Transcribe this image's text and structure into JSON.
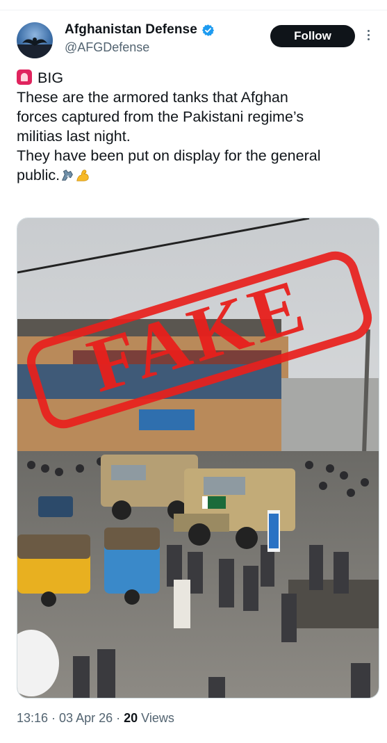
{
  "author": {
    "display_name": "Afghanistan Defense",
    "handle": "@AFGDefense",
    "verified": true,
    "avatar_icon": "eagle-emblem-icon"
  },
  "actions": {
    "follow_label": "Follow",
    "more_icon": "more-vertical-icon"
  },
  "tweet": {
    "lines": [
      "BIG",
      "These are the armored tanks that Afghan",
      "forces captured from the Pakistani regime’s",
      "militias last night.",
      "They have been put on display for the general",
      "public."
    ],
    "lead_icon": "rotating-light-icon",
    "trailing_icons": [
      "mechanical-arm-icon",
      "flexed-biceps-icon"
    ]
  },
  "media": {
    "stamp_text": "FAKE",
    "vehicle_flag_icon": "pakistan-flag-icon"
  },
  "meta": {
    "time_date": "13:16 · 03 Apr 26 · ",
    "views_count": "20",
    "views_label": " Views"
  },
  "colors": {
    "follow_bg": "#0f1419",
    "verified_blue": "#1d9bf0",
    "stamp_red": "#e8201c",
    "secondary_text": "#536471"
  }
}
